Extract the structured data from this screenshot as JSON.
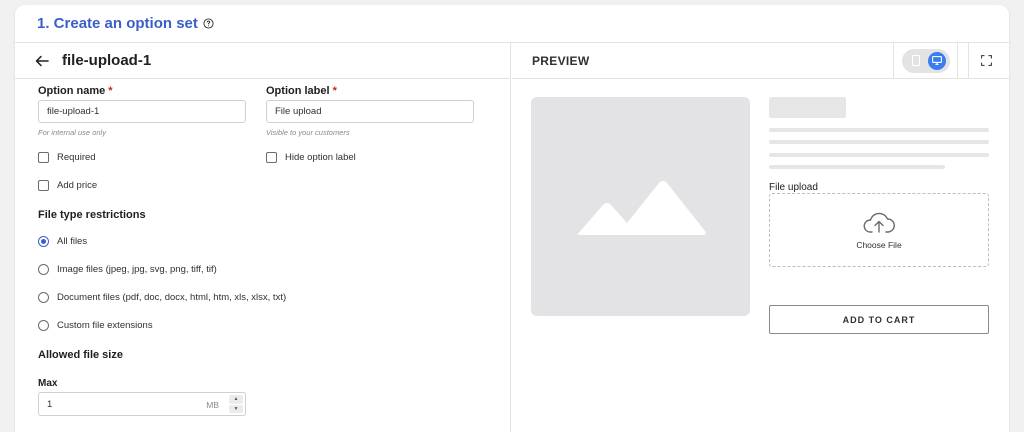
{
  "header": {
    "title": "1. Create an option set"
  },
  "editor": {
    "title": "file-upload-1",
    "option_name": {
      "label": "Option name",
      "required_mark": "*",
      "value": "file-upload-1",
      "hint": "For internal use only"
    },
    "option_label": {
      "label": "Option label",
      "required_mark": "*",
      "value": "File upload",
      "hint": "Visible to your customers"
    },
    "checkboxes": {
      "required": "Required",
      "hide_label": "Hide option label",
      "add_price": "Add price"
    },
    "file_type": {
      "title": "File type restrictions",
      "options": [
        {
          "label": "All files",
          "selected": true
        },
        {
          "label": "Image files (jpeg, jpg, svg, png, tiff, tif)",
          "selected": false
        },
        {
          "label": "Document files (pdf, doc, docx, html, htm, xls, xlsx, txt)",
          "selected": false
        },
        {
          "label": "Custom file extensions",
          "selected": false
        }
      ]
    },
    "file_size": {
      "title": "Allowed file size",
      "max_label": "Max",
      "max_value": "1",
      "unit": "MB"
    }
  },
  "preview": {
    "title": "PREVIEW",
    "upload_label": "File upload",
    "choose_file": "Choose File",
    "add_to_cart": "ADD TO CART",
    "active_device": "desktop"
  },
  "colors": {
    "accent": "#3b5fc8",
    "toggle_active": "#3b7cf0",
    "required": "#c5280c"
  }
}
